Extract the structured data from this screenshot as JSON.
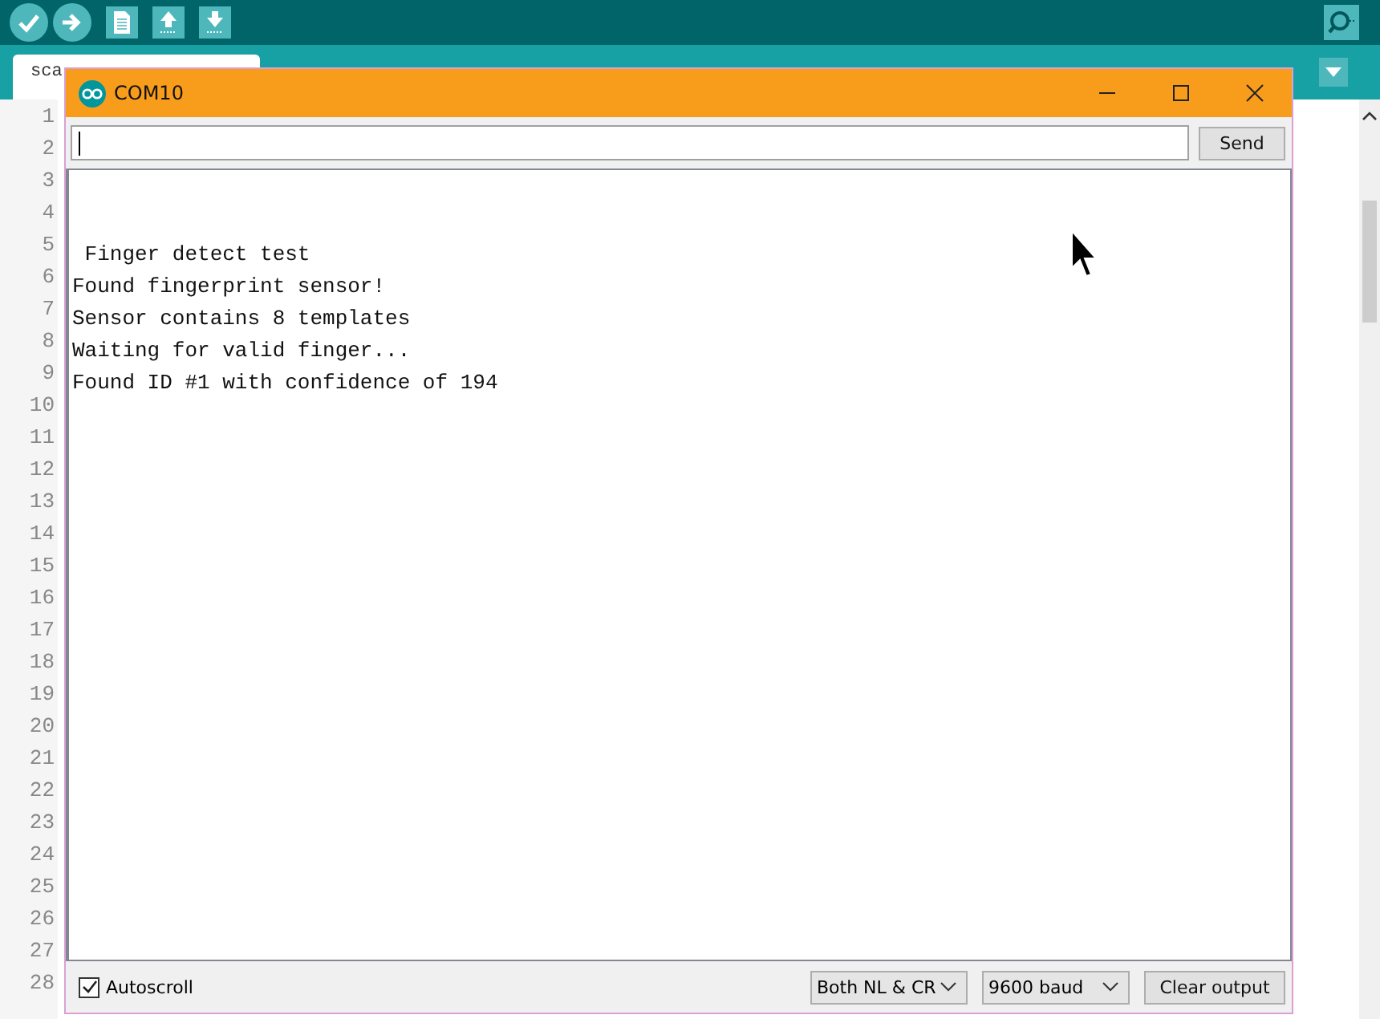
{
  "ide": {
    "toolbar": {
      "buttons": [
        {
          "kind": "verify"
        },
        {
          "kind": "upload"
        },
        {
          "kind": "new"
        },
        {
          "kind": "open"
        },
        {
          "kind": "save"
        }
      ],
      "right_button": {
        "kind": "serial"
      }
    },
    "tabs": [
      {
        "label": "sca"
      }
    ],
    "line_numbers": [
      "1",
      "2",
      "3",
      "4",
      "5",
      "6",
      "7",
      "8",
      "9",
      "10",
      "11",
      "12",
      "13",
      "14",
      "15",
      "16",
      "17",
      "18",
      "19",
      "20",
      "21",
      "22",
      "23",
      "24",
      "25",
      "26",
      "27",
      "28"
    ]
  },
  "serial_monitor": {
    "window": {
      "title": "COM10"
    },
    "send_button": "Send",
    "output": [
      " Finger detect test",
      "Found fingerprint sensor!",
      "Sensor contains 8 templates",
      "Waiting for valid finger...",
      "Found ID #1 with confidence of 194"
    ],
    "autoscroll": {
      "label": "Autoscroll",
      "checked": true
    },
    "line_ending": "Both NL & CR",
    "baud": "9600 baud",
    "clear_button": "Clear output"
  }
}
